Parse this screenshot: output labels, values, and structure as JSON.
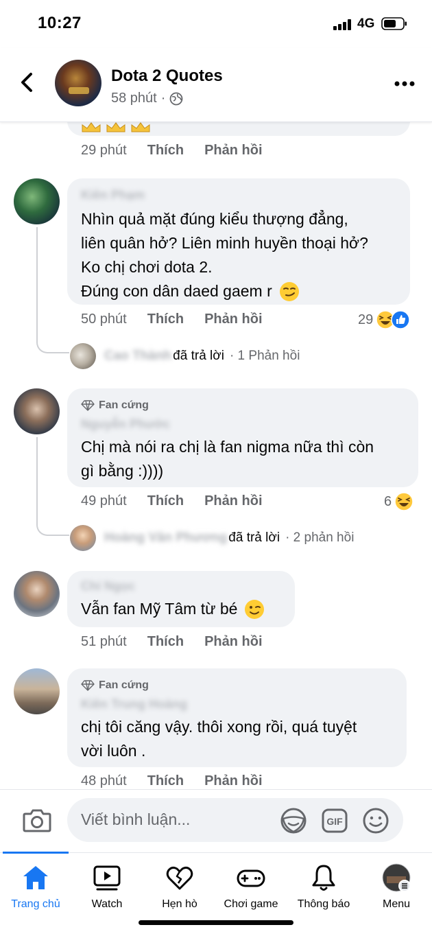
{
  "status": {
    "time": "10:27",
    "network": "4G"
  },
  "header": {
    "title": "Dota 2 Quotes",
    "time": "58 phút"
  },
  "comments": [
    {
      "time": "29 phút",
      "like": "Thích",
      "reply": "Phản hồi"
    },
    {
      "author": "Kiên Phạm",
      "lines": [
        "Nhìn quả mặt đúng kiểu thượng đẳng,",
        "liên quân hở? Liên minh huyền thoại hở?",
        "Ko chị chơi dota 2.",
        "Đúng con dân daed gaem r"
      ],
      "time": "50 phút",
      "like": "Thích",
      "reply": "Phản hồi",
      "reactions": "29",
      "replied_by": "Cao Thành",
      "replied_text": "đã trả lời",
      "reply_count": "· 1 Phản hồi"
    },
    {
      "badge": "Fan cứng",
      "author": "Nguyễn Phước",
      "lines": [
        "Chị mà nói ra chị là fan nigma nữa thì còn",
        "gì bằng :))))"
      ],
      "time": "49 phút",
      "like": "Thích",
      "reply": "Phản hồi",
      "reactions": "6",
      "replied_by": "Hoàng Văn Phương",
      "replied_text": "đã trả lời",
      "reply_count": "· 2 phản hồi"
    },
    {
      "author": "Chí Ngọc",
      "lines": [
        "Vẫn fan Mỹ Tâm từ bé"
      ],
      "time": "51 phút",
      "like": "Thích",
      "reply": "Phản hồi"
    },
    {
      "badge": "Fan cứng",
      "author": "Kiên Trung Hoàng",
      "lines": [
        "chị tôi căng vậy. thôi xong rồi, quá tuyệt",
        "vời luôn ."
      ],
      "time": "48 phút",
      "like": "Thích",
      "reply": "Phản hồi"
    }
  ],
  "composer": {
    "placeholder": "Viết bình luận..."
  },
  "tabs": [
    {
      "label": "Trang chủ",
      "icon": "home-icon"
    },
    {
      "label": "Watch",
      "icon": "watch-icon"
    },
    {
      "label": "Hẹn hò",
      "icon": "heart-icon"
    },
    {
      "label": "Chơi game",
      "icon": "gamepad-icon"
    },
    {
      "label": "Thông báo",
      "icon": "bell-icon"
    },
    {
      "label": "Menu",
      "icon": "menu-avatar-icon"
    }
  ],
  "colors": {
    "accent": "#1877f2",
    "bubble": "#f0f2f5",
    "muted": "#65676b"
  }
}
